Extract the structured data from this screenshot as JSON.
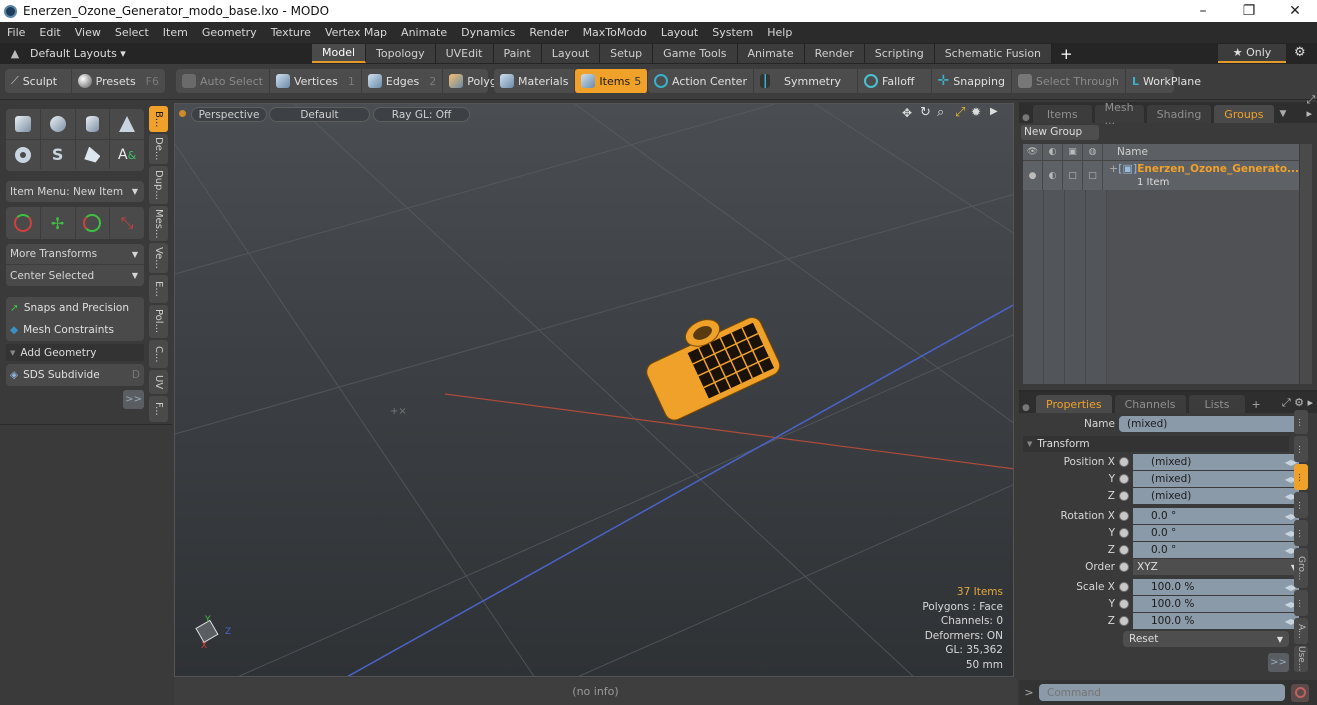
{
  "window": {
    "title": "Enerzen_Ozone_Generator_modo_base.lxo - MODO",
    "minimize": "–",
    "maximize": "❐",
    "close": "✕"
  },
  "menu": [
    "File",
    "Edit",
    "View",
    "Select",
    "Item",
    "Geometry",
    "Texture",
    "Vertex Map",
    "Animate",
    "Dynamics",
    "Render",
    "MaxToModo",
    "Layout",
    "System",
    "Help"
  ],
  "layoutbar": {
    "layouts_label": "Default Layouts ▾",
    "tabs": [
      "Model",
      "Topology",
      "UVEdit",
      "Paint",
      "Layout",
      "Setup",
      "Game Tools",
      "Animate",
      "Render",
      "Scripting",
      "Schematic Fusion"
    ],
    "active_tab": "Model",
    "add": "+",
    "only_label": "★ Only",
    "gear": "⚙"
  },
  "toolbar": {
    "sculpt": "Sculpt",
    "presets": "Presets",
    "presets_key": "F6",
    "auto_select": "Auto Select",
    "vertices": "Vertices",
    "vertices_key": "1",
    "edges": "Edges",
    "edges_key": "2",
    "polygons": "Polygons",
    "materials": "Materials",
    "items": "Items",
    "items_key": "5",
    "action_center": "Action Center",
    "symmetry": "Symmetry",
    "falloff": "Falloff",
    "snapping": "Snapping",
    "select_through": "Select Through",
    "workplane": "WorkPlane"
  },
  "leftpanel": {
    "item_menu": "Item Menu: New Item",
    "more_transforms": "More Transforms",
    "center_selected": "Center Selected",
    "snaps": "Snaps and Precision",
    "mesh_constraints": "Mesh Constraints",
    "add_geometry": "Add Geometry",
    "sds_subdivide": "SDS Subdivide",
    "sds_key": "D",
    "more": ">>",
    "vtabs": [
      "B...",
      "De...",
      "Dup...",
      "Mes...",
      "Ve...",
      "E...",
      "Pol...",
      "C...",
      "UV",
      "F..."
    ]
  },
  "viewport": {
    "projection": "Perspective",
    "shading": "Default",
    "raygl": "Ray GL: Off",
    "stats": {
      "items": "37 Items",
      "polygons": "Polygons : Face",
      "channels": "Channels: 0",
      "deformers": "Deformers: ON",
      "gl": "GL: 35,362",
      "unit": "50 mm"
    },
    "status": "(no info)"
  },
  "groups": {
    "tabs": [
      "Items",
      "Mesh ...",
      "Shading",
      "Groups"
    ],
    "active_tab": "Groups",
    "new_group": "New Group",
    "col_name": "Name",
    "row_name": "Enerzen_Ozone_Generato...",
    "row_sub": "1 Item"
  },
  "properties": {
    "tabs": [
      "Properties",
      "Channels",
      "Lists"
    ],
    "active_tab": "Properties",
    "add": "+",
    "name_label": "Name",
    "name_value": "(mixed)",
    "section": "Transform",
    "rows": [
      {
        "label": "Position X",
        "value": "(mixed)"
      },
      {
        "label": "Y",
        "value": "(mixed)"
      },
      {
        "label": "Z",
        "value": "(mixed)"
      },
      {
        "label": "Rotation X",
        "value": "0.0 °"
      },
      {
        "label": "Y",
        "value": "0.0 °"
      },
      {
        "label": "Z",
        "value": "0.0 °"
      },
      {
        "label": "Order",
        "value": "XYZ"
      },
      {
        "label": "Scale X",
        "value": "100.0 %"
      },
      {
        "label": "Y",
        "value": "100.0 %"
      },
      {
        "label": "Z",
        "value": "100.0 %"
      }
    ],
    "reset": "Reset",
    "more": ">>",
    "vtabs": [
      "...",
      "...",
      "...",
      "...",
      "...",
      "Gro...",
      "...",
      "A...",
      "Use...",
      "..."
    ]
  },
  "command": {
    "prompt": ">",
    "placeholder": "Command"
  },
  "colors": {
    "accent": "#f0a12a",
    "selection": "#f0a12a",
    "x_axis": "#c8513f",
    "z_axis": "#4a63c8"
  }
}
